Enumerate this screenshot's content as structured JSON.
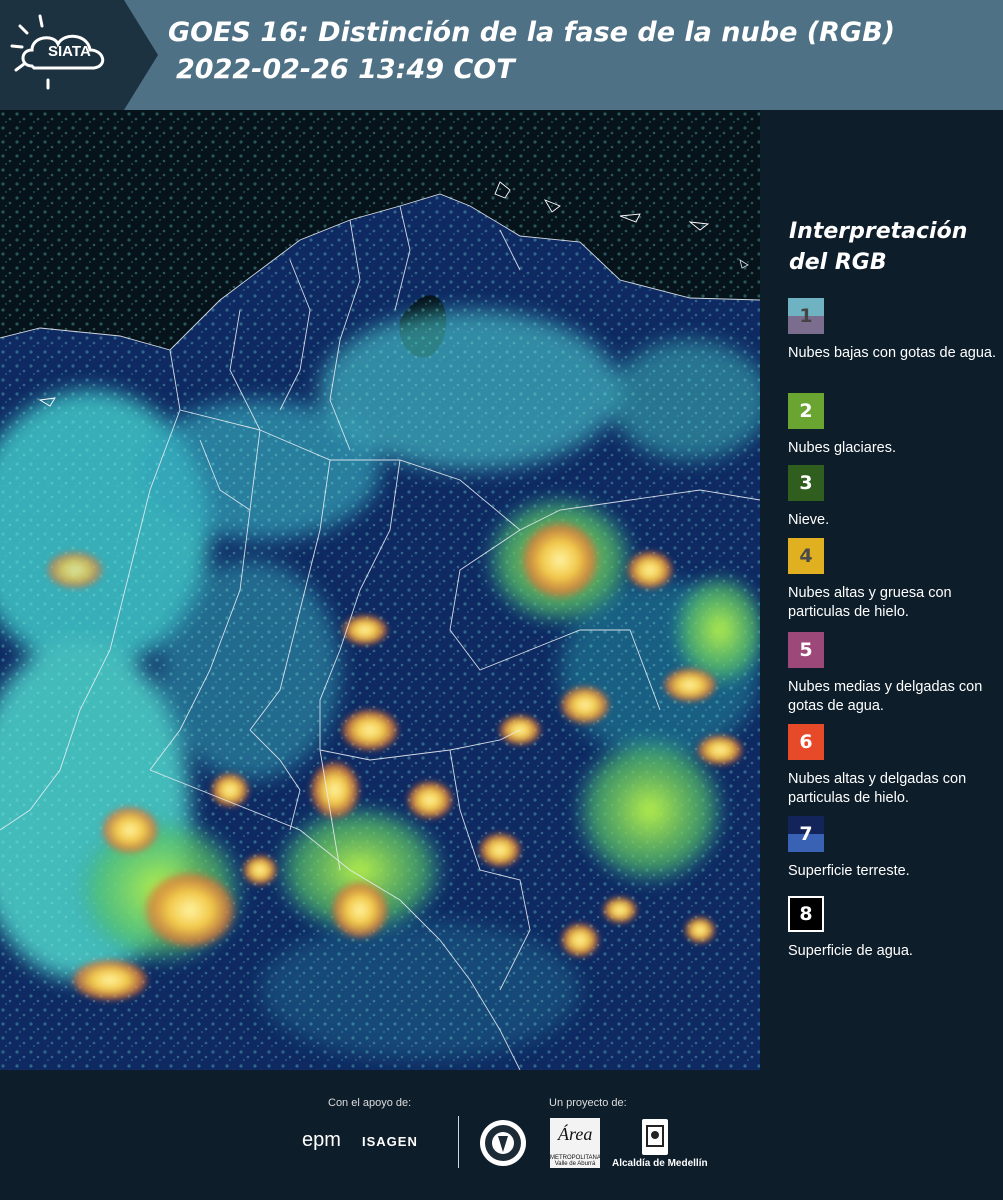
{
  "header": {
    "logo_text": "SIATA",
    "title_line1": "GOES 16: Distinción de la fase de la nube (RGB)",
    "title_line2": "2022-02-26 13:49 COT"
  },
  "legend": {
    "title": "Interpretación del RGB",
    "items": [
      {
        "num": "1",
        "label": "Nubes bajas con gotas de agua.",
        "color_top": "#6fb3c2",
        "color_bottom": "#7a6d8e",
        "num_color": "#444444"
      },
      {
        "num": "2",
        "label": "Nubes glaciares.",
        "color_top": "#6aa532",
        "color_bottom": "#6aa532",
        "num_color": "#ffffff"
      },
      {
        "num": "3",
        "label": "Nieve.",
        "color_top": "#2f5e1e",
        "color_bottom": "#2f5e1e",
        "num_color": "#ffffff"
      },
      {
        "num": "4",
        "label": "Nubes altas y gruesa con particulas de hielo.",
        "color_top": "#e0b021",
        "color_bottom": "#e0b021",
        "num_color": "#4a4a4a"
      },
      {
        "num": "5",
        "label": "Nubes medias y delgadas con gotas de agua.",
        "color_top": "#9c4878",
        "color_bottom": "#9c4878",
        "num_color": "#ffffff"
      },
      {
        "num": "6",
        "label": "Nubes altas y delgadas con particulas de hielo.",
        "color_top": "#e64a28",
        "color_bottom": "#e64a28",
        "num_color": "#ffffff"
      },
      {
        "num": "7",
        "label": "Superficie terreste.",
        "color_top": "#13245a",
        "color_bottom": "#3a62b4",
        "num_color": "#ffffff"
      },
      {
        "num": "8",
        "label": "Superficie de agua.",
        "color_top": "#000000",
        "color_bottom": "#000000",
        "num_color": "#ffffff"
      }
    ]
  },
  "footer": {
    "support_label": "Con el apoyo de:",
    "project_label": "Un proyecto de:",
    "sponsor_1": "epm",
    "sponsor_2": "ISAGEN",
    "area_logo_text": "Área",
    "area_caption": "METROPOLITANA Valle de Aburrá",
    "partner_2": "Alcaldía de Medellín"
  },
  "colors": {
    "header_bg": "#4e7185",
    "logo_bg": "#1d3240",
    "page_bg": "#0d1d2a",
    "map_water": "#07141d",
    "map_land": "#10295e",
    "cloud_low": "#5fe3d8",
    "cloud_high": "#f4e15a"
  }
}
